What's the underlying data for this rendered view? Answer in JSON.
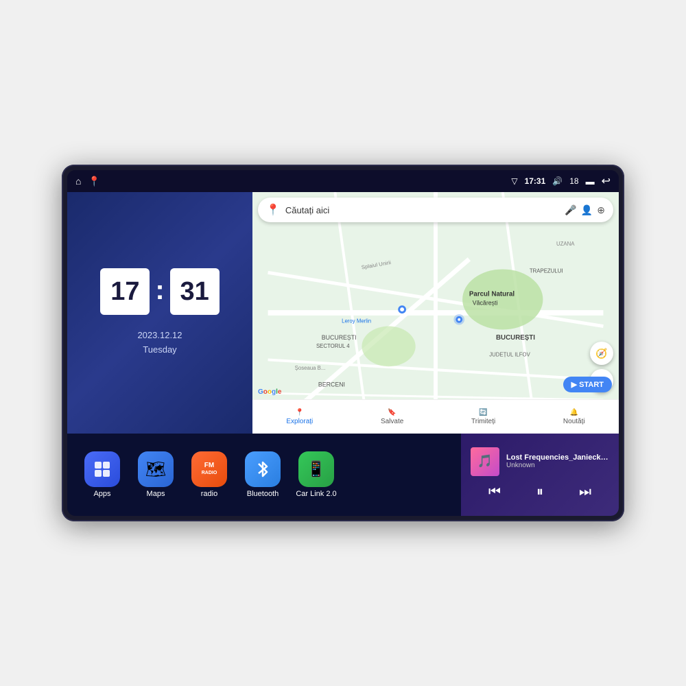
{
  "device": {
    "status_bar": {
      "left_icons": [
        "home",
        "location"
      ],
      "time": "17:31",
      "volume_icon": "🔊",
      "battery_level": "18",
      "battery_icon": "🔋",
      "back_icon": "↩"
    },
    "clock": {
      "hour": "17",
      "minute": "31",
      "date": "2023.12.12",
      "day": "Tuesday"
    },
    "map": {
      "search_placeholder": "Căutați aici",
      "location_pin": "📍",
      "nav_items": [
        {
          "label": "Explorați",
          "icon": "📍",
          "active": true
        },
        {
          "label": "Salvate",
          "icon": "🔖",
          "active": false
        },
        {
          "label": "Trimiteți",
          "icon": "🔄",
          "active": false
        },
        {
          "label": "Noutăți",
          "icon": "🔔",
          "active": false
        }
      ],
      "places": [
        "Parcul Natural Văcărești",
        "Leroy Merlin",
        "BUCUREȘTI SECTORUL 4",
        "BERCENI",
        "BUCUREȘTI",
        "JUDEȚUL ILFOV",
        "TRAPEZULUI",
        "UZANA",
        "Splaiul Unirii",
        "Șoseaua B..."
      ]
    },
    "apps": [
      {
        "id": "apps",
        "label": "Apps",
        "icon": "⊞",
        "color_class": "app-apps"
      },
      {
        "id": "maps",
        "label": "Maps",
        "icon": "🗺",
        "color_class": "app-maps"
      },
      {
        "id": "radio",
        "label": "radio",
        "icon": "📻",
        "color_class": "app-radio"
      },
      {
        "id": "bluetooth",
        "label": "Bluetooth",
        "icon": "⬡",
        "color_class": "app-bluetooth"
      },
      {
        "id": "carlink",
        "label": "Car Link 2.0",
        "icon": "📱",
        "color_class": "app-carlink"
      }
    ],
    "music": {
      "title": "Lost Frequencies_Janieck Devy-...",
      "artist": "Unknown",
      "controls": {
        "prev": "⏮",
        "play": "⏸",
        "next": "⏭"
      }
    }
  }
}
